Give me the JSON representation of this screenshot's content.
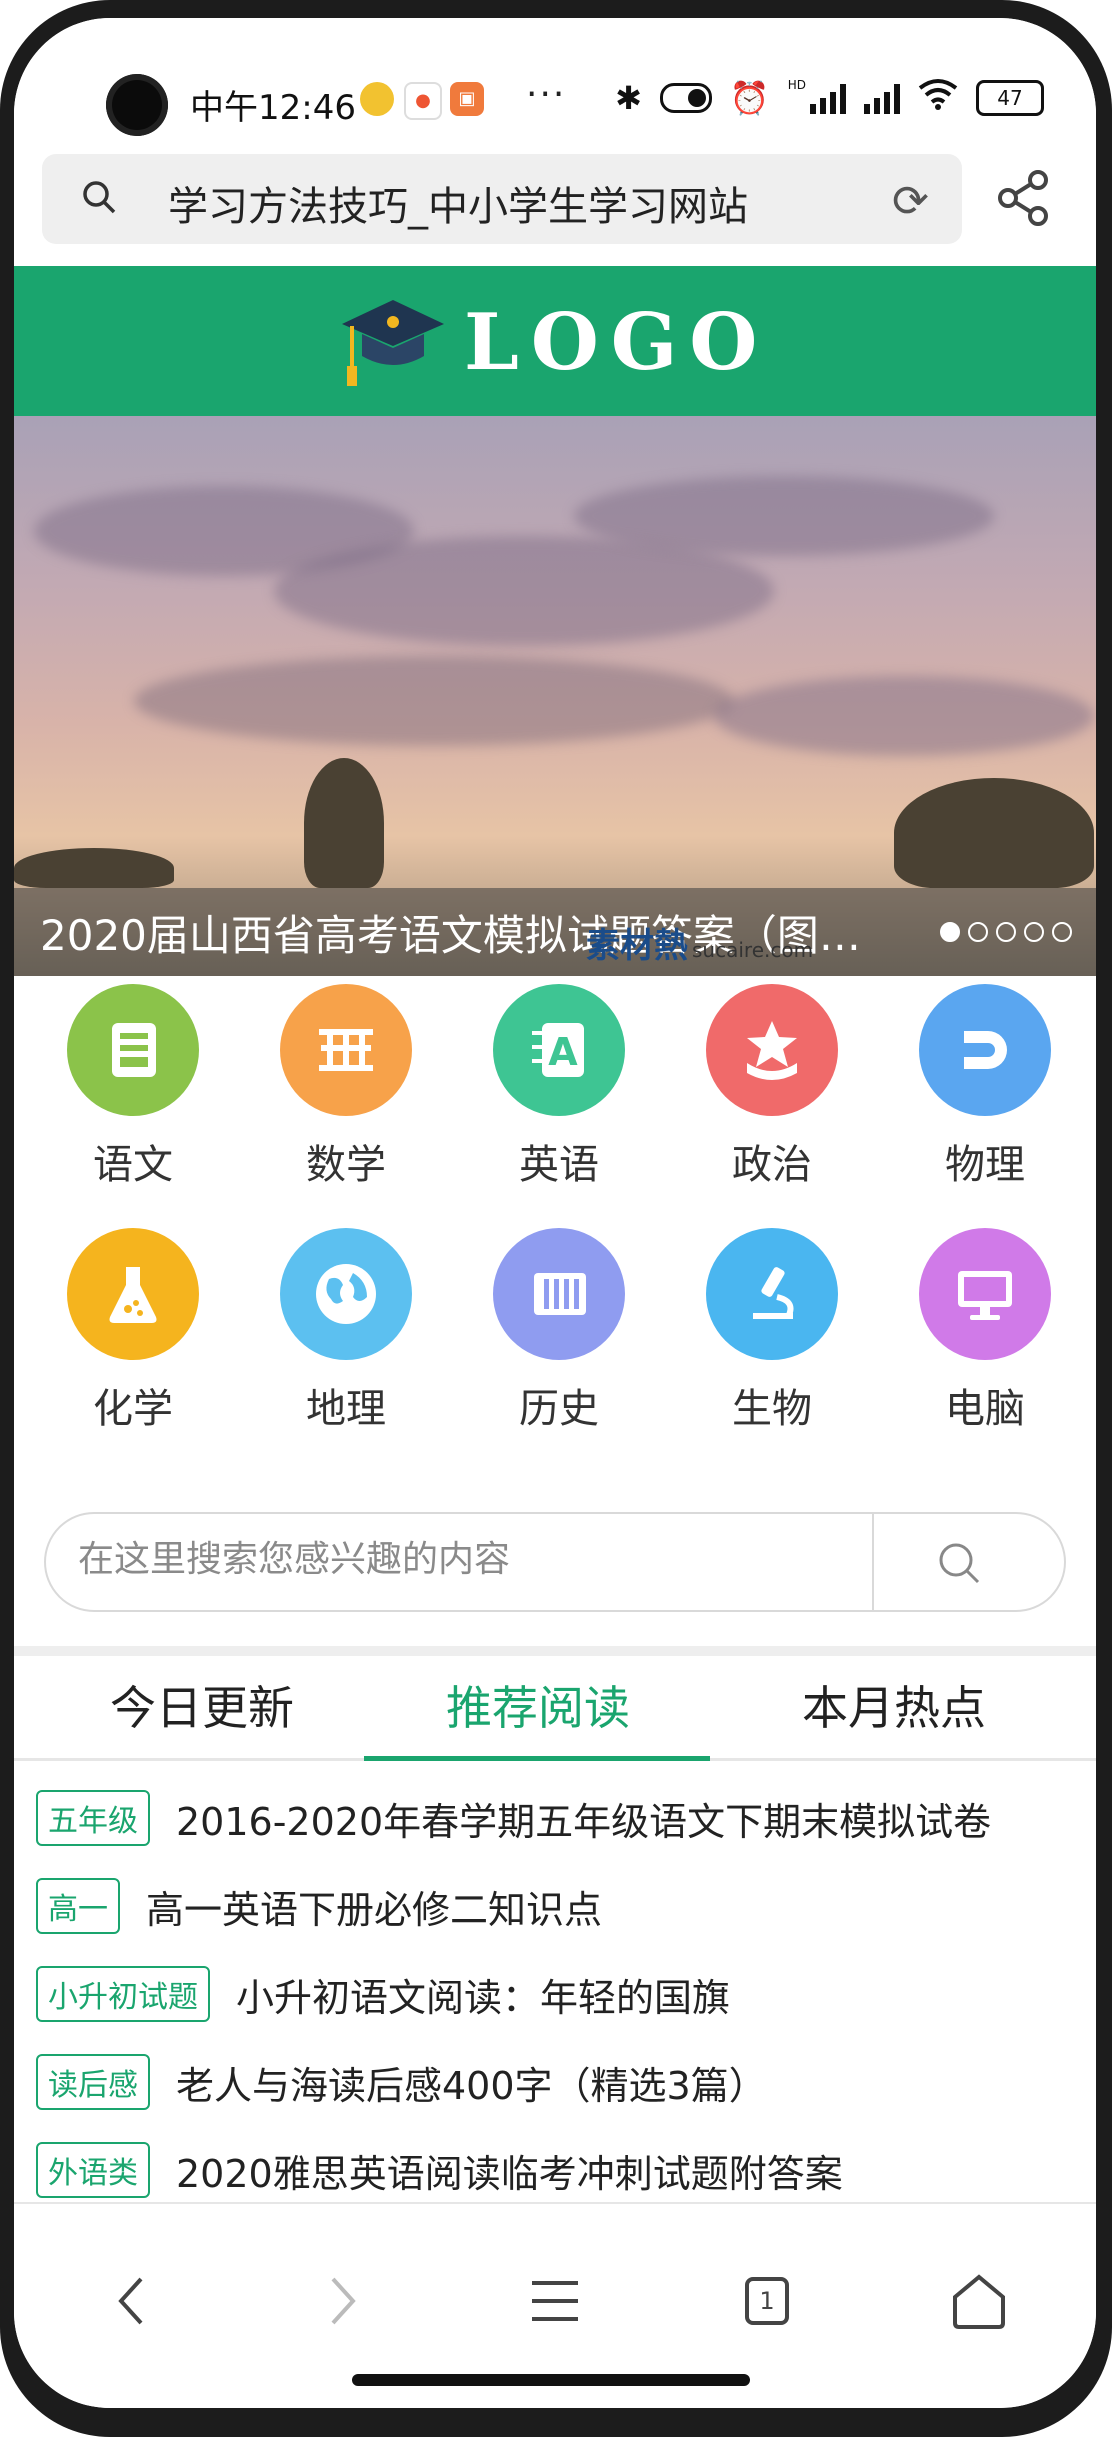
{
  "status_bar": {
    "time": "中午12:46",
    "more": "···",
    "battery": "47",
    "network_label": "HD"
  },
  "browser": {
    "page_title": "学习方法技巧_中小学生学习网站"
  },
  "header": {
    "logo_text": "LOGO",
    "brand_color": "#1aa56e"
  },
  "banner": {
    "caption": "2020届山西省高考语文模拟试题答案（图片...",
    "slide_count": 5,
    "active_slide": 1
  },
  "watermark": {
    "text": "素材熱",
    "domain": "sucaire.com"
  },
  "subjects": [
    {
      "label": "语文",
      "icon": "chinese-book-icon",
      "color": "#8bc34a"
    },
    {
      "label": "数学",
      "icon": "abacus-icon",
      "color": "#f7a24a"
    },
    {
      "label": "英语",
      "icon": "english-letter-icon",
      "color": "#3ec593"
    },
    {
      "label": "政治",
      "icon": "star-badge-icon",
      "color": "#f06a6a"
    },
    {
      "label": "物理",
      "icon": "magnet-icon",
      "color": "#5aa6f0"
    },
    {
      "label": "化学",
      "icon": "flask-icon",
      "color": "#f5b41e"
    },
    {
      "label": "地理",
      "icon": "globe-icon",
      "color": "#5cc0f0"
    },
    {
      "label": "历史",
      "icon": "scroll-icon",
      "color": "#8f9cf0"
    },
    {
      "label": "生物",
      "icon": "microscope-icon",
      "color": "#4ab6f0"
    },
    {
      "label": "电脑",
      "icon": "monitor-icon",
      "color": "#d07ae8"
    }
  ],
  "search": {
    "placeholder": "在这里搜索您感兴趣的内容"
  },
  "tabs": [
    {
      "label": "今日更新",
      "active": false
    },
    {
      "label": "推荐阅读",
      "active": true
    },
    {
      "label": "本月热点",
      "active": false
    }
  ],
  "articles": [
    {
      "tag": "五年级",
      "title": "2016-2020年春学期五年级语文下期末模拟试卷"
    },
    {
      "tag": "高一",
      "title": "高一英语下册必修二知识点"
    },
    {
      "tag": "小升初试题",
      "title": "小升初语文阅读：年轻的国旗"
    },
    {
      "tag": "读后感",
      "title": "老人与海读后感400字（精选3篇）"
    },
    {
      "tag": "外语类",
      "title": "2020雅思英语阅读临考冲刺试题附答案"
    }
  ],
  "bottom_nav": {
    "tab_count": "1"
  }
}
